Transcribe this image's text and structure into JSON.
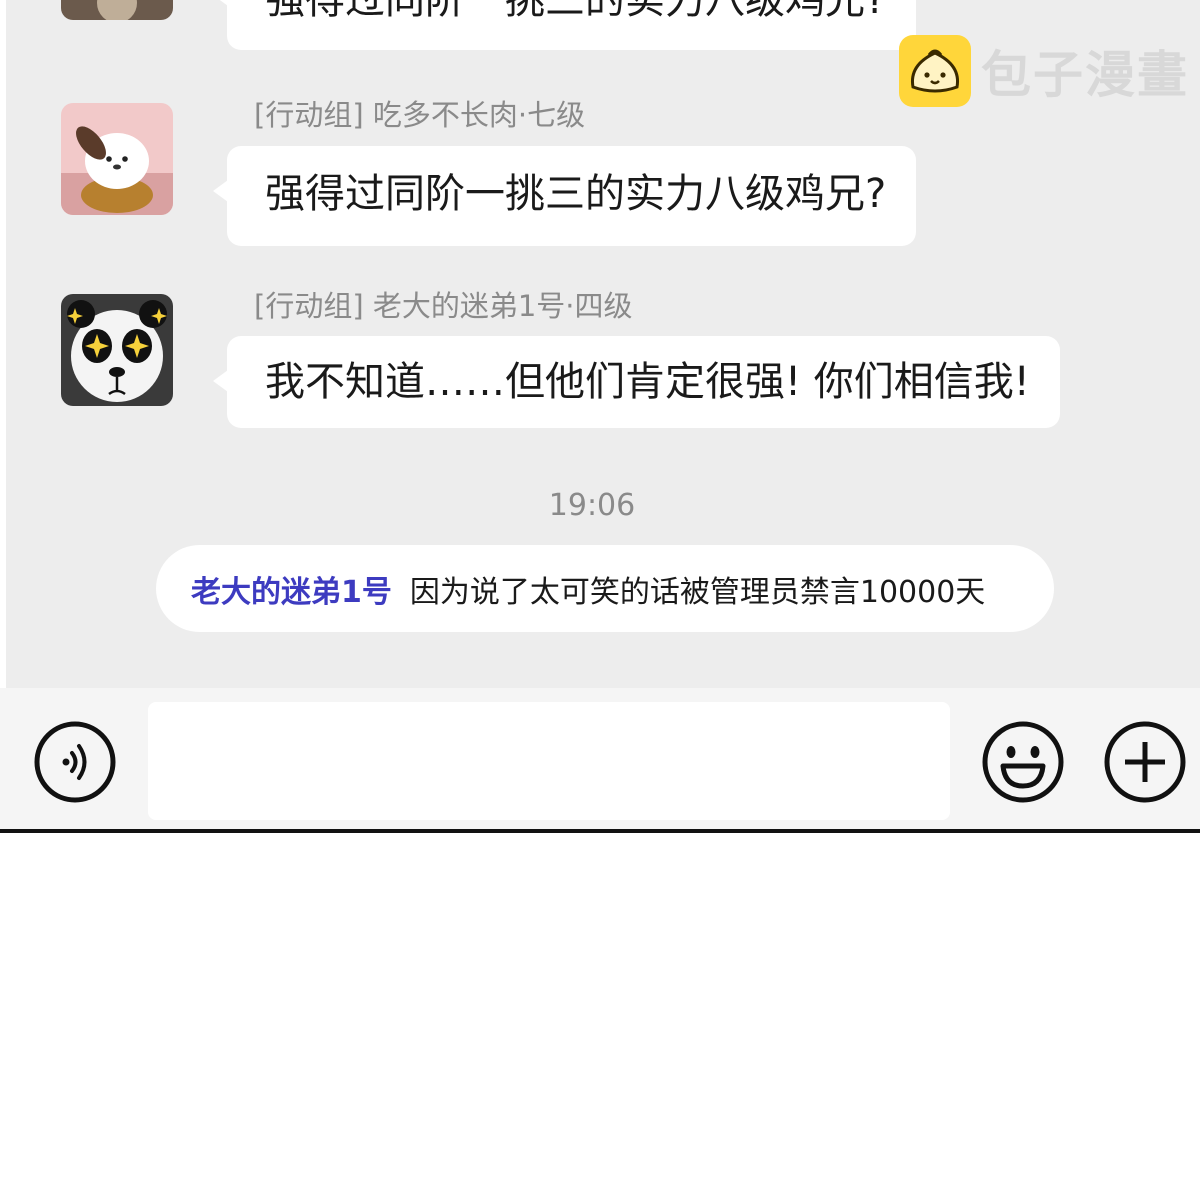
{
  "chat": {
    "messages": [
      {
        "sender": "",
        "text": "强得过同阶一挑三的实力八级鸡兄?"
      },
      {
        "sender": "[行动组]  吃多不长肉·七级",
        "text": "强得过同阶一挑三的实力八级鸡兄?"
      },
      {
        "sender": "[行动组]  老大的迷弟1号·四级",
        "text": "我不知道……但他们肯定很强! 你们相信我!"
      }
    ],
    "timestamp": "19:06",
    "system_notice": {
      "name": "老大的迷弟1号",
      "text": "因为说了太可笑的话被管理员禁言10000天"
    }
  },
  "watermark": {
    "text": "包子漫畫"
  },
  "input_bar": {
    "voice_icon": "voice-icon",
    "emoji_icon": "smiley-icon",
    "more_icon": "plus-icon"
  },
  "colors": {
    "chat_bg": "#ededed",
    "bubble_bg": "#ffffff",
    "notice_name": "#3d3bc0",
    "watermark_logo": "#ffd63a"
  }
}
